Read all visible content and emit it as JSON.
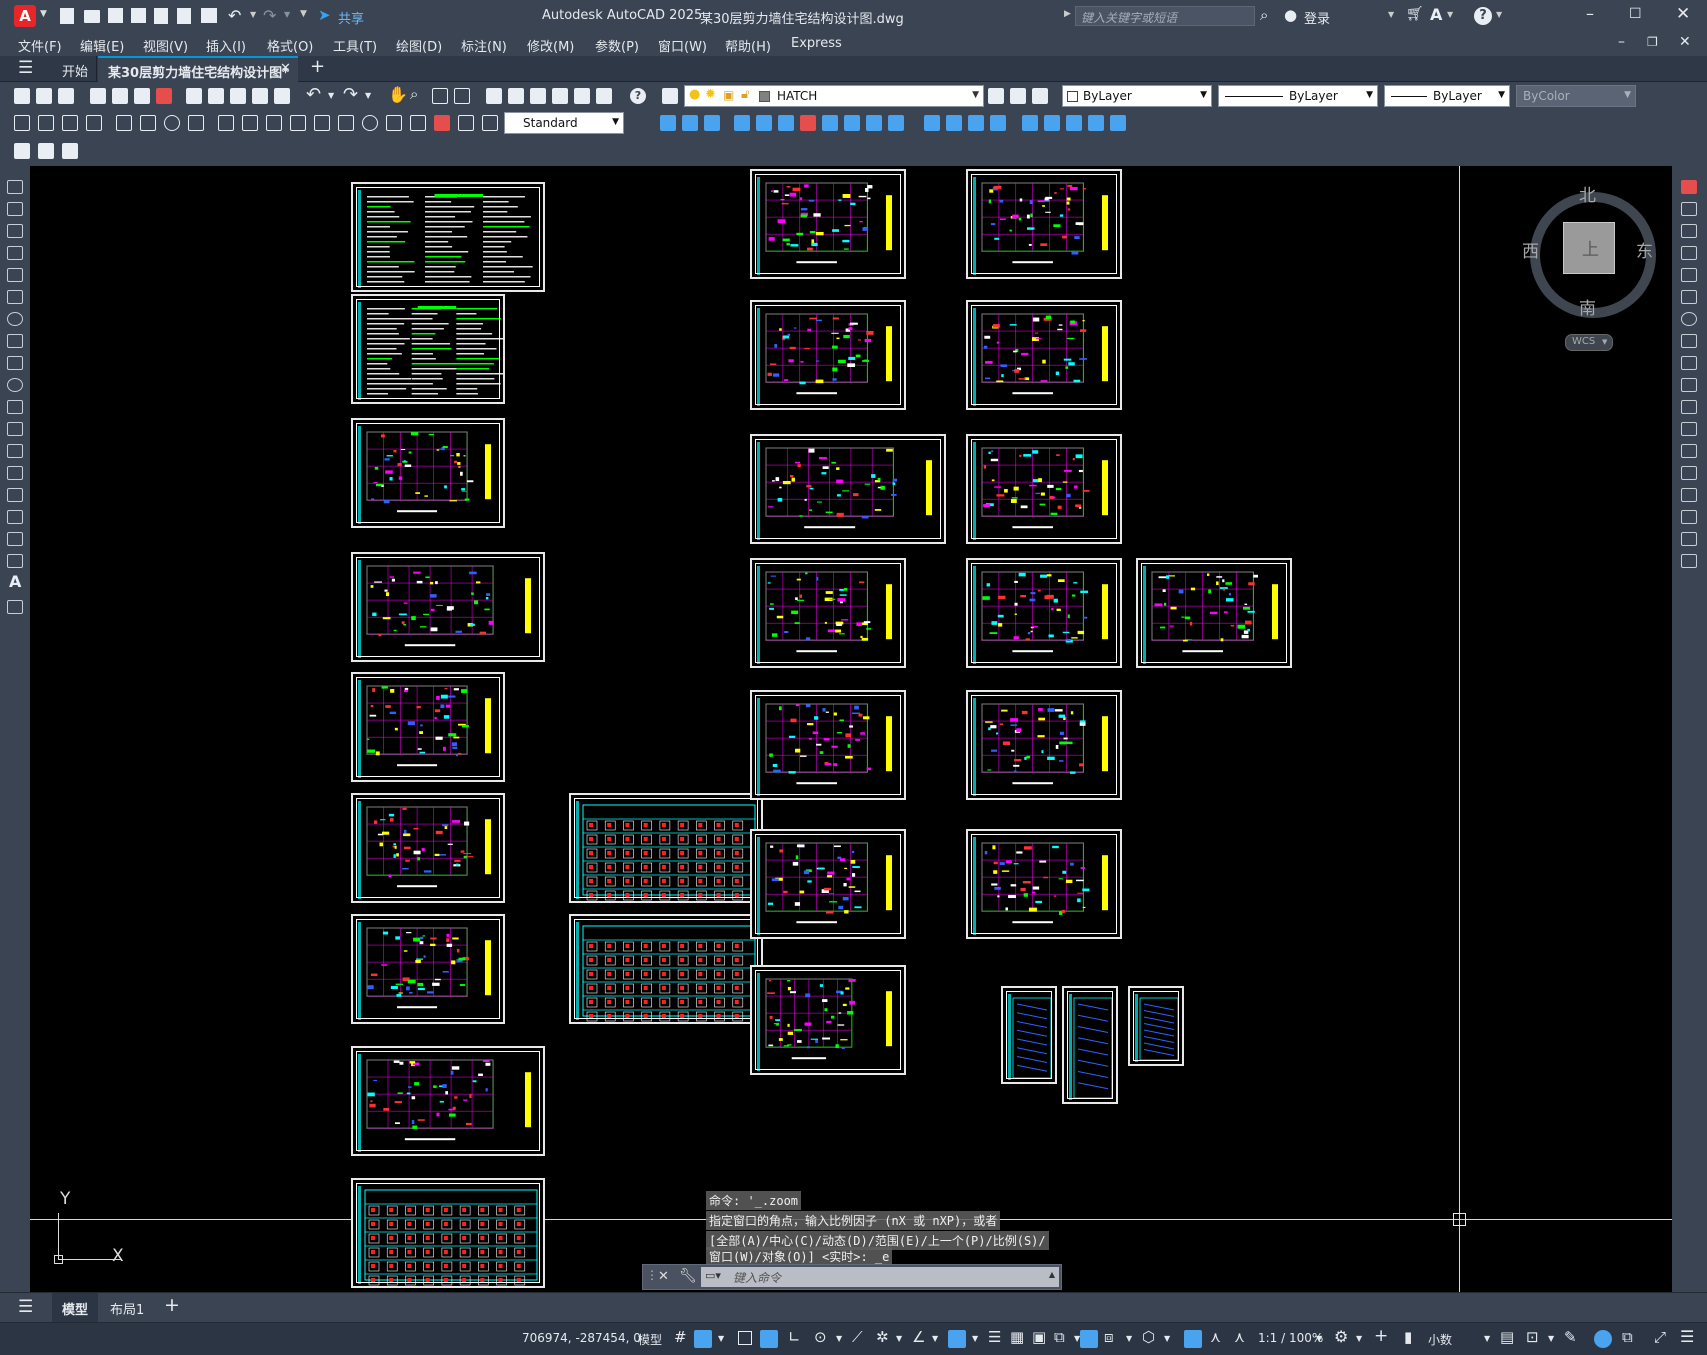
{
  "titlebar": {
    "app_title": "Autodesk AutoCAD 2025",
    "file_title": "某30层剪力墙住宅结构设计图.dwg",
    "share_label": "共享",
    "search_placeholder": "键入关键字或短语",
    "signin_label": "登录",
    "help_icon": "?"
  },
  "menu": {
    "items": [
      "文件(F)",
      "编辑(E)",
      "视图(V)",
      "插入(I)",
      "格式(O)",
      "工具(T)",
      "绘图(D)",
      "标注(N)",
      "修改(M)",
      "参数(P)",
      "窗口(W)",
      "帮助(H)",
      "Express"
    ]
  },
  "tabs": {
    "start_label": "开始",
    "doc_label": "某30层剪力墙住宅结构设计图*",
    "add_label": "+"
  },
  "toolbar": {
    "layer_name": "HATCH",
    "color_value": "ByLayer",
    "linetype_value": "ByLayer",
    "lineweight_value": "ByLayer",
    "plotstyle_value": "ByColor",
    "textstyle_value": "Standard"
  },
  "viewcube": {
    "north": "北",
    "south": "南",
    "east": "东",
    "west": "西",
    "face": "上",
    "wcs": "WCS"
  },
  "ucs": {
    "x_label": "X",
    "y_label": "Y"
  },
  "command": {
    "history": [
      "命令: '_.zoom",
      "指定窗口的角点，输入比例因子 (nX 或 nXP)，或者",
      "[全部(A)/中心(C)/动态(D)/范围(E)/上一个(P)/比例(S)/",
      "窗口(W)/对象(O)] <实时>: _e"
    ],
    "placeholder": "键入命令"
  },
  "layout_tabs": {
    "model": "模型",
    "layout1": "布局1",
    "add": "+"
  },
  "status": {
    "coords": "706974, -287454, 0",
    "space": "模型",
    "scale": "1:1 / 100%",
    "units": "小数"
  },
  "colors": {
    "canvas_bg": "#000000",
    "ui_bg": "#3b4453",
    "accent": "#0696d7"
  }
}
